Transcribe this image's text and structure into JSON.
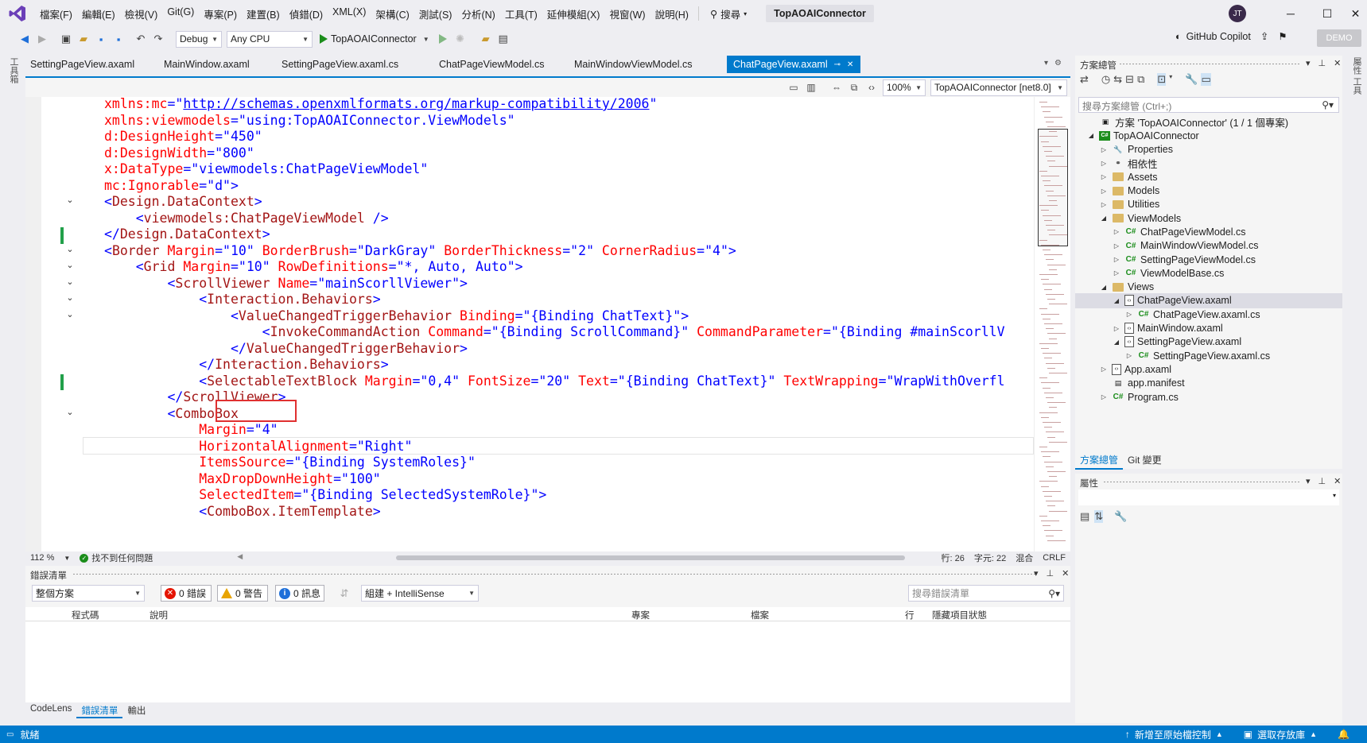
{
  "app": {
    "menu": [
      "檔案(F)",
      "編輯(E)",
      "檢視(V)",
      "Git(G)",
      "專案(P)",
      "建置(B)",
      "偵錯(D)",
      "XML(X)",
      "架構(C)",
      "測試(S)",
      "分析(N)",
      "工具(T)",
      "延伸模組(X)",
      "視窗(W)",
      "說明(H)"
    ],
    "search_label": "搜尋",
    "solution_title": "TopAOAIConnector",
    "avatar_initials": "JT",
    "demo_badge": "DEMO",
    "copilot_label": "GitHub Copilot"
  },
  "toolbar": {
    "config": "Debug",
    "platform": "Any CPU",
    "run_target": "TopAOAIConnector"
  },
  "left_strip_label": "工具箱",
  "right_strip_label": "屬性 工具",
  "doc_tabs": [
    {
      "label": "SettingPageView.axaml",
      "active": false
    },
    {
      "label": "MainWindow.axaml",
      "active": false
    },
    {
      "label": "SettingPageView.axaml.cs",
      "active": false
    },
    {
      "label": "ChatPageViewModel.cs",
      "active": false
    },
    {
      "label": "MainWindowViewModel.cs",
      "active": false
    },
    {
      "label": "ChatPageView.axaml",
      "active": true
    }
  ],
  "editor": {
    "zoom_combo": "100%",
    "target_combo": "TopAOAIConnector [net8.0]",
    "lines": [
      [
        [
          "a",
          "xmlns:mc"
        ],
        [
          "b",
          "=\""
        ],
        [
          "l",
          "http://schemas.openxmlformats.org/markup-compatibility/2006"
        ],
        [
          "b",
          "\""
        ]
      ],
      [
        [
          "a",
          "xmlns:viewmodels"
        ],
        [
          "b",
          "=\""
        ],
        [
          "v",
          "using:TopAOAIConnector.ViewModels"
        ],
        [
          "b",
          "\""
        ]
      ],
      [
        [
          "a",
          "d:DesignHeight"
        ],
        [
          "b",
          "=\""
        ],
        [
          "v",
          "450"
        ],
        [
          "b",
          "\""
        ]
      ],
      [
        [
          "a",
          "d:DesignWidth"
        ],
        [
          "b",
          "=\""
        ],
        [
          "v",
          "800"
        ],
        [
          "b",
          "\""
        ]
      ],
      [
        [
          "a",
          "x:DataType"
        ],
        [
          "b",
          "=\""
        ],
        [
          "v",
          "viewmodels:ChatPageViewModel"
        ],
        [
          "b",
          "\""
        ]
      ],
      [
        [
          "a",
          "mc:Ignorable"
        ],
        [
          "b",
          "=\""
        ],
        [
          "v",
          "d"
        ],
        [
          "b",
          "\">"
        ]
      ],
      [
        [
          "b",
          "<"
        ],
        [
          "t",
          "Design.DataContext"
        ],
        [
          "b",
          ">"
        ]
      ],
      [
        [
          "b",
          "    <"
        ],
        [
          "t",
          "viewmodels:ChatPageViewModel"
        ],
        [
          "b",
          " />"
        ]
      ],
      [
        [
          "b",
          "</"
        ],
        [
          "t",
          "Design.DataContext"
        ],
        [
          "b",
          ">"
        ]
      ],
      [
        [
          "b",
          "<"
        ],
        [
          "t",
          "Border"
        ],
        [
          "a",
          " Margin"
        ],
        [
          "b",
          "=\""
        ],
        [
          "v",
          "10"
        ],
        [
          "b",
          "\""
        ],
        [
          "a",
          " BorderBrush"
        ],
        [
          "b",
          "=\""
        ],
        [
          "v",
          "DarkGray"
        ],
        [
          "b",
          "\""
        ],
        [
          "a",
          " BorderThickness"
        ],
        [
          "b",
          "=\""
        ],
        [
          "v",
          "2"
        ],
        [
          "b",
          "\""
        ],
        [
          "a",
          " CornerRadius"
        ],
        [
          "b",
          "=\""
        ],
        [
          "v",
          "4"
        ],
        [
          "b",
          "\">"
        ]
      ],
      [
        [
          "b",
          "    <"
        ],
        [
          "t",
          "Grid"
        ],
        [
          "a",
          " Margin"
        ],
        [
          "b",
          "=\""
        ],
        [
          "v",
          "10"
        ],
        [
          "b",
          "\""
        ],
        [
          "a",
          " RowDefinitions"
        ],
        [
          "b",
          "=\""
        ],
        [
          "v",
          "*, Auto, Auto"
        ],
        [
          "b",
          "\">"
        ]
      ],
      [
        [
          "b",
          "        <"
        ],
        [
          "t",
          "ScrollViewer"
        ],
        [
          "a",
          " Name"
        ],
        [
          "b",
          "=\""
        ],
        [
          "v",
          "mainScorllViewer"
        ],
        [
          "b",
          "\">"
        ]
      ],
      [
        [
          "b",
          "            <"
        ],
        [
          "t",
          "Interaction.Behaviors"
        ],
        [
          "b",
          ">"
        ]
      ],
      [
        [
          "b",
          "                <"
        ],
        [
          "t",
          "ValueChangedTriggerBehavior"
        ],
        [
          "a",
          " Binding"
        ],
        [
          "b",
          "=\""
        ],
        [
          "v",
          "{Binding ChatText}"
        ],
        [
          "b",
          "\">"
        ]
      ],
      [
        [
          "b",
          "                    <"
        ],
        [
          "t",
          "InvokeCommandAction"
        ],
        [
          "a",
          " Command"
        ],
        [
          "b",
          "=\""
        ],
        [
          "v",
          "{Binding ScrollCommand}"
        ],
        [
          "b",
          "\""
        ],
        [
          "a",
          " CommandParameter"
        ],
        [
          "b",
          "=\""
        ],
        [
          "v",
          "{Binding #mainScorllV"
        ]
      ],
      [
        [
          "b",
          "                </"
        ],
        [
          "t",
          "ValueChangedTriggerBehavior"
        ],
        [
          "b",
          ">"
        ]
      ],
      [
        [
          "b",
          "            </"
        ],
        [
          "t",
          "Interaction.Behaviors"
        ],
        [
          "b",
          ">"
        ]
      ],
      [
        [
          "b",
          "            <"
        ],
        [
          "t",
          "SelectableTextBlock"
        ],
        [
          "a",
          " Margin"
        ],
        [
          "b",
          "=\""
        ],
        [
          "v",
          "0,4"
        ],
        [
          "b",
          "\""
        ],
        [
          "a",
          " FontSize"
        ],
        [
          "b",
          "=\""
        ],
        [
          "v",
          "20"
        ],
        [
          "b",
          "\""
        ],
        [
          "a",
          " Text"
        ],
        [
          "b",
          "=\""
        ],
        [
          "v",
          "{Binding ChatText}"
        ],
        [
          "b",
          "\""
        ],
        [
          "a",
          " TextWrapping"
        ],
        [
          "b",
          "=\""
        ],
        [
          "v",
          "WrapWithOverfl"
        ]
      ],
      [
        [
          "b",
          "        </"
        ],
        [
          "t",
          "ScrollViewer"
        ],
        [
          "b",
          ">"
        ]
      ],
      [
        [
          "b",
          "        <"
        ],
        [
          "t",
          "ComboBox"
        ]
      ],
      [
        [
          "a",
          "            Margin"
        ],
        [
          "b",
          "=\""
        ],
        [
          "v",
          "4"
        ],
        [
          "b",
          "\""
        ]
      ],
      [
        [
          "a",
          "            HorizontalAlignment"
        ],
        [
          "b",
          "=\""
        ],
        [
          "v",
          "Right"
        ],
        [
          "b",
          "\""
        ]
      ],
      [
        [
          "a",
          "            ItemsSource"
        ],
        [
          "b",
          "=\""
        ],
        [
          "v",
          "{Binding SystemRoles}"
        ],
        [
          "b",
          "\""
        ]
      ],
      [
        [
          "a",
          "            MaxDropDownHeight"
        ],
        [
          "b",
          "=\""
        ],
        [
          "v",
          "100"
        ],
        [
          "b",
          "\""
        ]
      ],
      [
        [
          "a",
          "            SelectedItem"
        ],
        [
          "b",
          "=\""
        ],
        [
          "v",
          "{Binding SelectedSystemRole}"
        ],
        [
          "b",
          "\">"
        ]
      ],
      [
        [
          "b",
          "            <"
        ],
        [
          "t",
          "ComboBox.ItemTemplate"
        ],
        [
          "b",
          ">"
        ]
      ]
    ]
  },
  "editor_status": {
    "zoom": "112 %",
    "issues": "找不到任何問題",
    "line": "行: 26",
    "col": "字元: 22",
    "mode": "混合",
    "eol": "CRLF"
  },
  "error_list": {
    "title": "錯誤清單",
    "scope": "整個方案",
    "errors": "0 錯誤",
    "warnings": "0 警告",
    "messages": "0 訊息",
    "build_filter": "組建 + IntelliSense",
    "search_placeholder": "搜尋錯誤清單",
    "columns": [
      "",
      "程式碼",
      "說明",
      "專案",
      "檔案",
      "行",
      "隱藏項目狀態"
    ]
  },
  "bottom_tabs": [
    "CodeLens",
    "錯誤清單",
    "輸出"
  ],
  "solution_explorer": {
    "title": "方案總管",
    "search_placeholder": "搜尋方案總管 (Ctrl+;)",
    "tree": [
      {
        "label": "方案 'TopAOAIConnector' (1 / 1 個專案)",
        "depth": 0,
        "exp": "",
        "icon": "sln"
      },
      {
        "label": "TopAOAIConnector",
        "depth": 0,
        "exp": "◢",
        "icon": "proj"
      },
      {
        "label": "Properties",
        "depth": 1,
        "exp": "▷",
        "icon": "props"
      },
      {
        "label": "相依性",
        "depth": 1,
        "exp": "▷",
        "icon": "deps"
      },
      {
        "label": "Assets",
        "depth": 1,
        "exp": "▷",
        "icon": "folder"
      },
      {
        "label": "Models",
        "depth": 1,
        "exp": "▷",
        "icon": "folder"
      },
      {
        "label": "Utilities",
        "depth": 1,
        "exp": "▷",
        "icon": "folder"
      },
      {
        "label": "ViewModels",
        "depth": 1,
        "exp": "◢",
        "icon": "folder"
      },
      {
        "label": "ChatPageViewModel.cs",
        "depth": 2,
        "exp": "▷",
        "icon": "cs"
      },
      {
        "label": "MainWindowViewModel.cs",
        "depth": 2,
        "exp": "▷",
        "icon": "cs"
      },
      {
        "label": "SettingPageViewModel.cs",
        "depth": 2,
        "exp": "▷",
        "icon": "cs"
      },
      {
        "label": "ViewModelBase.cs",
        "depth": 2,
        "exp": "▷",
        "icon": "cs"
      },
      {
        "label": "Views",
        "depth": 1,
        "exp": "◢",
        "icon": "folder"
      },
      {
        "label": "ChatPageView.axaml",
        "depth": 2,
        "exp": "◢",
        "icon": "xaml",
        "selected": true
      },
      {
        "label": "ChatPageView.axaml.cs",
        "depth": 3,
        "exp": "▷",
        "icon": "cs"
      },
      {
        "label": "MainWindow.axaml",
        "depth": 2,
        "exp": "▷",
        "icon": "xaml"
      },
      {
        "label": "SettingPageView.axaml",
        "depth": 2,
        "exp": "◢",
        "icon": "xaml"
      },
      {
        "label": "SettingPageView.axaml.cs",
        "depth": 3,
        "exp": "▷",
        "icon": "cs"
      },
      {
        "label": "App.axaml",
        "depth": 1,
        "exp": "▷",
        "icon": "xaml"
      },
      {
        "label": "app.manifest",
        "depth": 1,
        "exp": "",
        "icon": "manifest"
      },
      {
        "label": "Program.cs",
        "depth": 1,
        "exp": "▷",
        "icon": "cs"
      }
    ],
    "tabs": [
      "方案總管",
      "Git 變更"
    ]
  },
  "properties": {
    "title": "屬性"
  },
  "statusbar": {
    "ready": "就緒",
    "source_control": "新增至原始檔控制",
    "repository": "選取存放庫"
  }
}
